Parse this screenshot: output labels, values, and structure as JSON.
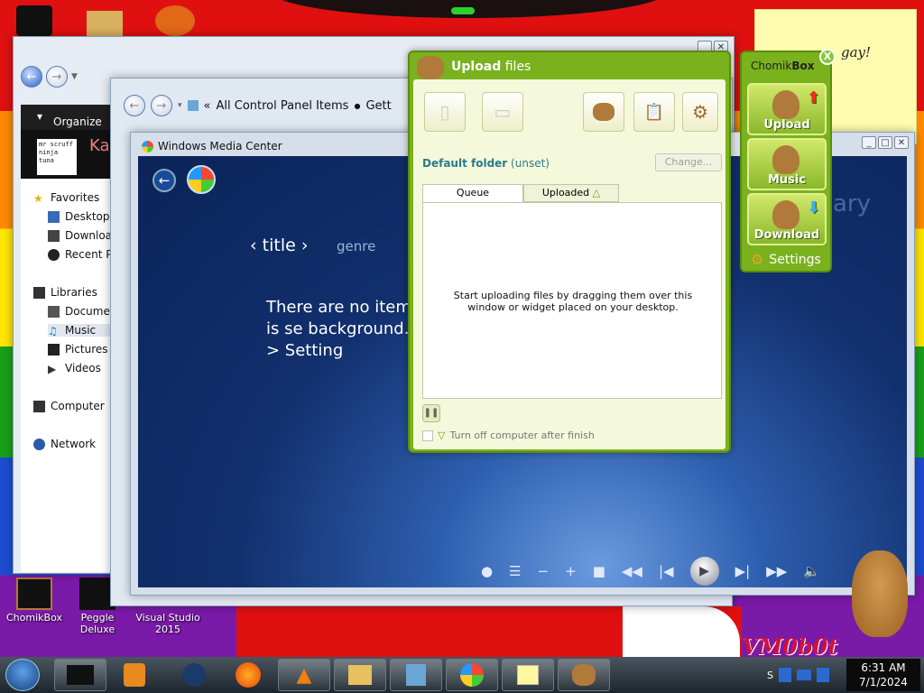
{
  "desktop": {
    "sticky_note": "gay!",
    "brand": "VM0b0t",
    "icons": [
      {
        "label": "ChomikBox"
      },
      {
        "label": "Peggle Deluxe"
      },
      {
        "label": "Visual Studio 2015"
      }
    ]
  },
  "explorer": {
    "organize_label": "Organize",
    "thumb_caption": "mr scruff\nninja tuna",
    "thumb_side_text": "Ka",
    "nav": {
      "favorites": "Favorites",
      "desktop": "Desktop",
      "downloads": "Download",
      "recent": "Recent Pl",
      "libraries": "Libraries",
      "documents": "Documer",
      "music": "Music",
      "pictures": "Pictures",
      "videos": "Videos",
      "computer": "Computer",
      "network": "Network"
    }
  },
  "control_panel": {
    "breadcrumb_prefix": "«",
    "breadcrumb": "All Control Panel Items",
    "breadcrumb_next": "Gett"
  },
  "media_center": {
    "title": "Windows Media Center",
    "sort_title": "title",
    "sort_genre": "genre",
    "message": "There are no items Media Center is se background. To ac to Tasks > Setting",
    "library_label": "ary"
  },
  "upload": {
    "title_bold": "Upload",
    "title_rest": " files",
    "default_folder_label": "Default folder",
    "default_folder_value": "(unset)",
    "change_button": "Change...",
    "tabs": [
      "Queue",
      "Uploaded"
    ],
    "empty_message": "Start uploading files by dragging them over this window or widget placed on your desktop.",
    "turn_off_label": "Turn off computer after finish"
  },
  "chomikbox": {
    "title_plain": "Chomik",
    "title_bold": "Box",
    "close": "X",
    "buttons": [
      "Upload",
      "Music",
      "Download"
    ],
    "settings": "Settings"
  },
  "taskbar": {
    "tray_s": "S",
    "time": "6:31 AM",
    "date": "7/1/2024"
  },
  "colors": {
    "widget_green": "#7ab21e",
    "wmc_blue": "#12306e",
    "link_teal": "#2c7a8c"
  }
}
